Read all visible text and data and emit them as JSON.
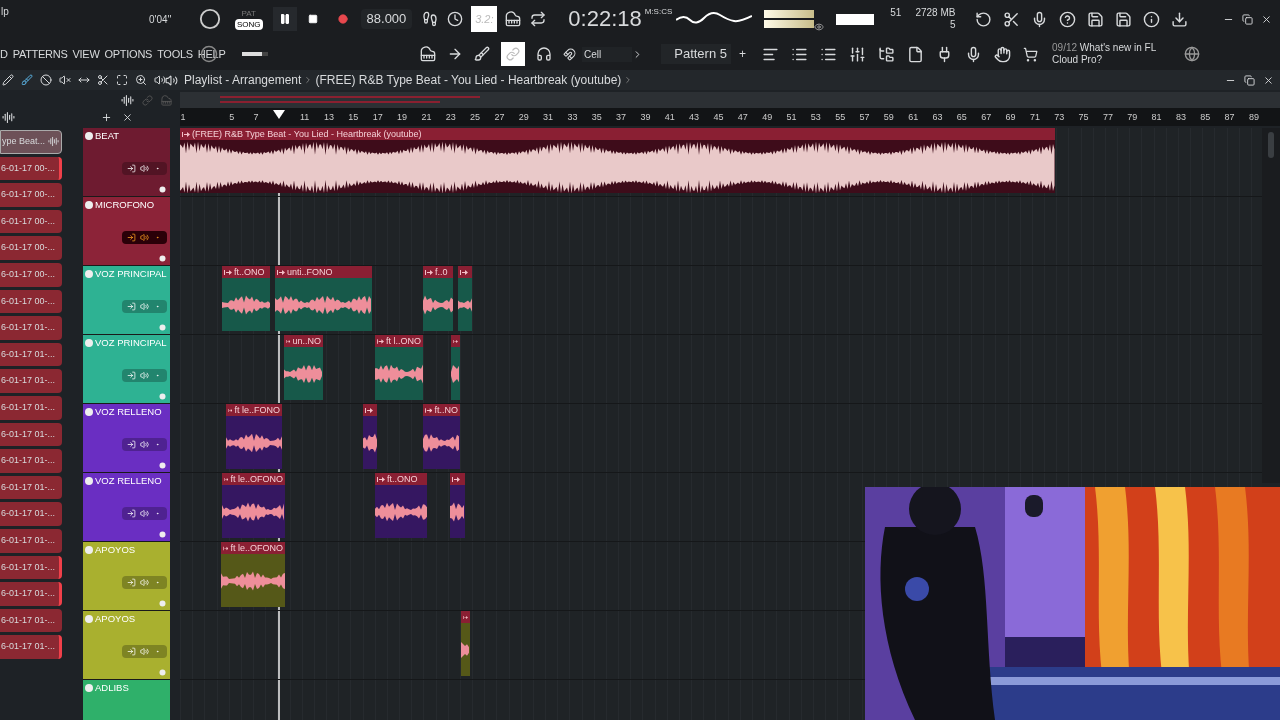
{
  "toolbar": {
    "file_label": "lp",
    "song_position": "0'04''",
    "modes": [
      {
        "label": "PAT",
        "selected": false
      },
      {
        "label": "SONG",
        "selected": true
      }
    ],
    "playing": true,
    "recording": true,
    "tempo": "88.000",
    "step_display": "3.2:",
    "time_unit": "M:S:CS",
    "time": "0:22:18",
    "cpu": "51",
    "memory": "2728 MB",
    "polyphony": "5"
  },
  "menu": [
    "D",
    "PATTERNS",
    "VIEW",
    "OPTIONS",
    "TOOLS",
    "HELP"
  ],
  "master_volume": {
    "level": 0.75
  },
  "snap": "Cell",
  "pattern": "Pattern 5",
  "pattern_add": "+",
  "news": {
    "count": "09/12",
    "text": "What's new in FL Cloud Pro?"
  },
  "playlist": {
    "title": "Playlist - Arrangement",
    "song": "(FREE) R&B Type Beat - You Lied - Heartbreak (youtube)",
    "ruler": [
      "1",
      "5",
      "7",
      "11",
      "13",
      "15",
      "17",
      "19",
      "21",
      "23",
      "25",
      "27",
      "29",
      "31",
      "33",
      "35",
      "37",
      "39",
      "41",
      "43",
      "45",
      "47",
      "49",
      "51",
      "53",
      "55",
      "57",
      "59",
      "61",
      "63",
      "65",
      "67",
      "69",
      "71",
      "73",
      "75",
      "77",
      "79",
      "81",
      "83",
      "85",
      "87",
      "89"
    ],
    "tracks": [
      {
        "name": "BEAT",
        "color": "#6e1b30",
        "armed": false,
        "clips": [
          {
            "kind": "beat",
            "label": "(FREE) R&B Type Beat - You Lied - Heartbreak (youtube)"
          }
        ]
      },
      {
        "name": "MICROFONO",
        "color": "#8c2338",
        "armed": true
      },
      {
        "name": "VOZ PRINCIPAL",
        "color": "#2eb293",
        "armed": false,
        "clips": [
          {
            "kind": "vocal",
            "label": "ft..ONO"
          },
          {
            "kind": "vocal",
            "label": "unti..FONO"
          },
          {
            "kind": "vocal",
            "label": "f..0"
          },
          {
            "kind": "vocal"
          }
        ]
      },
      {
        "name": "VOZ PRINCIPAL",
        "color": "#2eb293",
        "armed": false,
        "clips": [
          {
            "kind": "vocal",
            "label": "un..NO"
          },
          {
            "kind": "vocal",
            "label": "ft l..ONO"
          },
          {
            "kind": "vocal"
          }
        ]
      },
      {
        "name": "VOZ RELLENO",
        "color": "#6a2ec2",
        "armed": false,
        "clips": [
          {
            "kind": "vocal",
            "label": "ft le..FONO"
          },
          {
            "kind": "vocal"
          },
          {
            "kind": "vocal",
            "label": "ft..NO"
          }
        ]
      },
      {
        "name": "VOZ RELLENO",
        "color": "#6a2ec2",
        "armed": false,
        "clips": [
          {
            "kind": "vocal",
            "label": "ft le..OFONO"
          },
          {
            "kind": "vocal",
            "label": "ft..ONO"
          },
          {
            "kind": "vocal"
          }
        ]
      },
      {
        "name": "APOYOS",
        "color": "#a9b02f",
        "armed": false,
        "clips": [
          {
            "kind": "vocal",
            "label": "ft le..OFONO"
          }
        ]
      },
      {
        "name": "APOYOS",
        "color": "#a9b02f",
        "armed": false,
        "clips": [
          {
            "kind": "vocal"
          }
        ]
      },
      {
        "name": "ADLIBS",
        "color": "#2fb06a"
      }
    ]
  },
  "browser": [
    {
      "label": "ype Beat...",
      "selected": true,
      "marked": false
    },
    {
      "label": "6-01-17 00-...",
      "selected": false,
      "marked": true
    },
    {
      "label": "6-01-17 00-...",
      "selected": false,
      "marked": false
    },
    {
      "label": "6-01-17 00-...",
      "selected": false,
      "marked": false
    },
    {
      "label": "6-01-17 00-...",
      "selected": false,
      "marked": false
    },
    {
      "label": "6-01-17 00-...",
      "selected": false,
      "marked": false
    },
    {
      "label": "6-01-17 00-...",
      "selected": false,
      "marked": false
    },
    {
      "label": "6-01-17 01-...",
      "selected": false,
      "marked": false
    },
    {
      "label": "6-01-17 01-...",
      "selected": false,
      "marked": false
    },
    {
      "label": "6-01-17 01-...",
      "selected": false,
      "marked": false
    },
    {
      "label": "6-01-17 01-...",
      "selected": false,
      "marked": false
    },
    {
      "label": "6-01-17 01-...",
      "selected": false,
      "marked": false
    },
    {
      "label": "6-01-17 01-...",
      "selected": false,
      "marked": false
    },
    {
      "label": "6-01-17 01-...",
      "selected": false,
      "marked": false
    },
    {
      "label": "6-01-17 01-...",
      "selected": false,
      "marked": false
    },
    {
      "label": "6-01-17 01-...",
      "selected": false,
      "marked": false
    },
    {
      "label": "6-01-17 01-...",
      "selected": false,
      "marked": true
    },
    {
      "label": "6-01-17 01-...",
      "selected": false,
      "marked": true
    },
    {
      "label": "6-01-17 01-...",
      "selected": false,
      "marked": false
    },
    {
      "label": "6-01-17 01-...",
      "selected": false,
      "marked": true
    }
  ]
}
